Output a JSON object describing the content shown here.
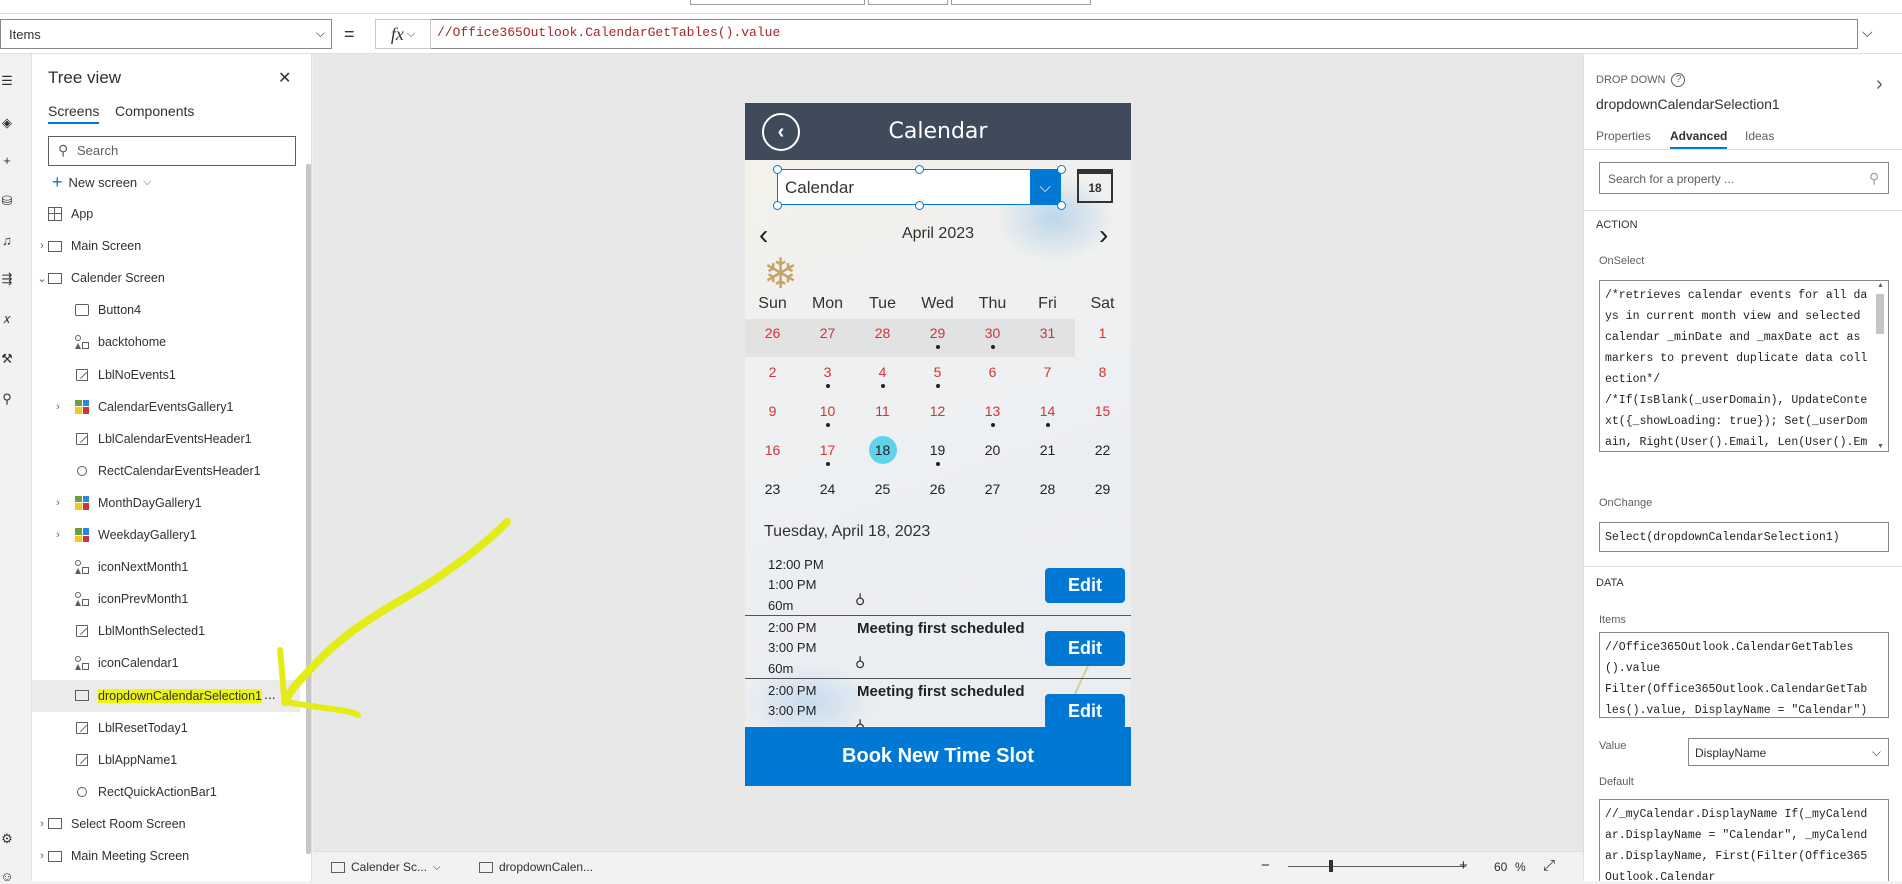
{
  "formula_bar": {
    "property": "Items",
    "equals": "=",
    "fx": "fx",
    "formula": "//Office365Outlook.CalendarGetTables().value"
  },
  "rail_icons": [
    "hamburger-icon",
    "layers-icon",
    "plus-icon",
    "database-icon",
    "media-icon",
    "power-automate-icon",
    "variables-icon",
    "advanced-tools-icon",
    "search-icon",
    "settings-icon",
    "virtual-agent-icon"
  ],
  "tree": {
    "title": "Tree view",
    "tabs": [
      "Screens",
      "Components"
    ],
    "search_placeholder": "Search",
    "new_screen": "New screen",
    "items": [
      {
        "label": "App",
        "level": 0,
        "icon": "app-icon",
        "expand": ""
      },
      {
        "label": "Main Screen",
        "level": 0,
        "icon": "screen-icon",
        "expand": "›"
      },
      {
        "label": "Calender Screen",
        "level": 0,
        "icon": "screen-icon",
        "expand": "⌄"
      },
      {
        "label": "Button4",
        "level": 1,
        "icon": "button-icon",
        "expand": ""
      },
      {
        "label": "backtohome",
        "level": 1,
        "icon": "shape-icon",
        "expand": ""
      },
      {
        "label": "LblNoEvents1",
        "level": 1,
        "icon": "label-icon",
        "expand": ""
      },
      {
        "label": "CalendarEventsGallery1",
        "level": 1,
        "icon": "gallery-icon",
        "expand": "›"
      },
      {
        "label": "LblCalendarEventsHeader1",
        "level": 1,
        "icon": "label-icon",
        "expand": ""
      },
      {
        "label": "RectCalendarEventsHeader1",
        "level": 1,
        "icon": "rect-icon",
        "expand": ""
      },
      {
        "label": "MonthDayGallery1",
        "level": 1,
        "icon": "gallery-icon",
        "expand": "›"
      },
      {
        "label": "WeekdayGallery1",
        "level": 1,
        "icon": "gallery-icon",
        "expand": "›"
      },
      {
        "label": "iconNextMonth1",
        "level": 1,
        "icon": "shape-icon",
        "expand": ""
      },
      {
        "label": "iconPrevMonth1",
        "level": 1,
        "icon": "shape-icon",
        "expand": ""
      },
      {
        "label": "LblMonthSelected1",
        "level": 1,
        "icon": "label-icon",
        "expand": ""
      },
      {
        "label": "iconCalendar1",
        "level": 1,
        "icon": "shape-icon",
        "expand": ""
      },
      {
        "label": "dropdownCalendarSelection1",
        "level": 1,
        "icon": "dropdown-icon",
        "expand": "",
        "selected": true,
        "more": "..."
      },
      {
        "label": "LblResetToday1",
        "level": 1,
        "icon": "label-icon",
        "expand": ""
      },
      {
        "label": "LblAppName1",
        "level": 1,
        "icon": "label-icon",
        "expand": ""
      },
      {
        "label": "RectQuickActionBar1",
        "level": 1,
        "icon": "rect-icon",
        "expand": ""
      },
      {
        "label": "Select Room Screen",
        "level": 0,
        "icon": "screen-icon",
        "expand": "›"
      },
      {
        "label": "Main Meeting Screen",
        "level": 0,
        "icon": "screen-icon",
        "expand": "›"
      }
    ]
  },
  "app": {
    "title": "Calendar",
    "dropdown_value": "Calendar",
    "calendar_icon_day": "18",
    "month": "April 2023",
    "weekdays": [
      "Sun",
      "Mon",
      "Tue",
      "Wed",
      "Thu",
      "Fri",
      "Sat"
    ],
    "days": [
      {
        "n": "26",
        "red": true,
        "prev": true,
        "dot": false
      },
      {
        "n": "27",
        "red": true,
        "prev": true,
        "dot": false
      },
      {
        "n": "28",
        "red": true,
        "prev": true,
        "dot": false
      },
      {
        "n": "29",
        "red": true,
        "prev": true,
        "dot": true
      },
      {
        "n": "30",
        "red": true,
        "prev": true,
        "dot": true
      },
      {
        "n": "31",
        "red": true,
        "prev": true,
        "dot": false
      },
      {
        "n": "1",
        "red": true,
        "prev": false,
        "dot": false
      },
      {
        "n": "2",
        "red": true,
        "dot": false
      },
      {
        "n": "3",
        "red": true,
        "dot": true
      },
      {
        "n": "4",
        "red": true,
        "dot": true
      },
      {
        "n": "5",
        "red": true,
        "dot": true
      },
      {
        "n": "6",
        "red": true,
        "dot": false
      },
      {
        "n": "7",
        "red": true,
        "dot": false
      },
      {
        "n": "8",
        "red": true,
        "dot": false
      },
      {
        "n": "9",
        "red": true,
        "dot": false
      },
      {
        "n": "10",
        "red": true,
        "dot": true
      },
      {
        "n": "11",
        "red": true,
        "dot": false
      },
      {
        "n": "12",
        "red": true,
        "dot": false
      },
      {
        "n": "13",
        "red": true,
        "dot": true
      },
      {
        "n": "14",
        "red": true,
        "dot": true
      },
      {
        "n": "15",
        "red": true,
        "dot": false
      },
      {
        "n": "16",
        "red": true,
        "dot": false
      },
      {
        "n": "17",
        "red": true,
        "dot": true
      },
      {
        "n": "18",
        "red": false,
        "dot": false,
        "today": true
      },
      {
        "n": "19",
        "red": false,
        "dot": true
      },
      {
        "n": "20",
        "red": false,
        "dot": false
      },
      {
        "n": "21",
        "red": false,
        "dot": false
      },
      {
        "n": "22",
        "red": false,
        "dot": false
      },
      {
        "n": "23",
        "red": false,
        "dot": false
      },
      {
        "n": "24",
        "red": false,
        "dot": false
      },
      {
        "n": "25",
        "red": false,
        "dot": false
      },
      {
        "n": "26",
        "red": false,
        "dot": false
      },
      {
        "n": "27",
        "red": false,
        "dot": false
      },
      {
        "n": "28",
        "red": false,
        "dot": false
      },
      {
        "n": "29",
        "red": false,
        "dot": false
      }
    ],
    "selected_date": "Tuesday, April 18, 2023",
    "events": [
      {
        "start": "12:00 PM",
        "end": "1:00 PM",
        "duration": "60m",
        "title": "",
        "edit": "Edit"
      },
      {
        "start": "2:00 PM",
        "end": "3:00 PM",
        "duration": "60m",
        "title": "Meeting first scheduled",
        "edit": "Edit"
      },
      {
        "start": "2:00 PM",
        "end": "3:00 PM",
        "duration": "",
        "title": "Meeting first scheduled",
        "edit": "Edit"
      }
    ],
    "book_button": "Book New Time Slot"
  },
  "bottom_bar": {
    "screen": "Calender Sc...",
    "control": "dropdownCalen...",
    "zoom_minus": "−",
    "zoom_plus": "+",
    "zoom": "60",
    "zoom_unit": "%",
    "zoom_level": 0.6
  },
  "properties": {
    "control_type": "DROP DOWN",
    "control_name": "dropdownCalendarSelection1",
    "tabs": [
      "Properties",
      "Advanced",
      "Ideas"
    ],
    "active_tab": "Advanced",
    "search_placeholder": "Search for a property ...",
    "section_action": "ACTION",
    "onselect_label": "OnSelect",
    "onselect_code": "/*retrieves calendar events for all days in current month view and selected calendar _minDate and _maxDate act as markers to prevent duplicate data collection*/\n/*If(IsBlank(_userDomain), UpdateContext({_showLoading: true}); Set(_userDomain, Right(User().Email, Len(User().Email) - Find(\"@\", User().Email))); Set(_dateSelected",
    "onchange_label": "OnChange",
    "onchange_code": "Select(dropdownCalendarSelection1)",
    "section_data": "DATA",
    "items_label": "Items",
    "items_code": "//Office365Outlook.CalendarGetTables().value\nFilter(Office365Outlook.CalendarGetTables().value, DisplayName = \"Calendar\")",
    "value_label": "Value",
    "value_value": "DisplayName",
    "default_label": "Default",
    "default_code": "//_myCalendar.DisplayName If(_myCalendar.DisplayName = \"Calendar\", _myCalendar.DisplayName, First(Filter(Office365Outlook.Calendar"
  },
  "colors": {
    "accent": "#0078d4",
    "header": "#3f4b5b",
    "red_day": "#d13438",
    "today": "#5fd3e9",
    "highlight": "#eef50f",
    "annotation": "#e3ec16"
  }
}
